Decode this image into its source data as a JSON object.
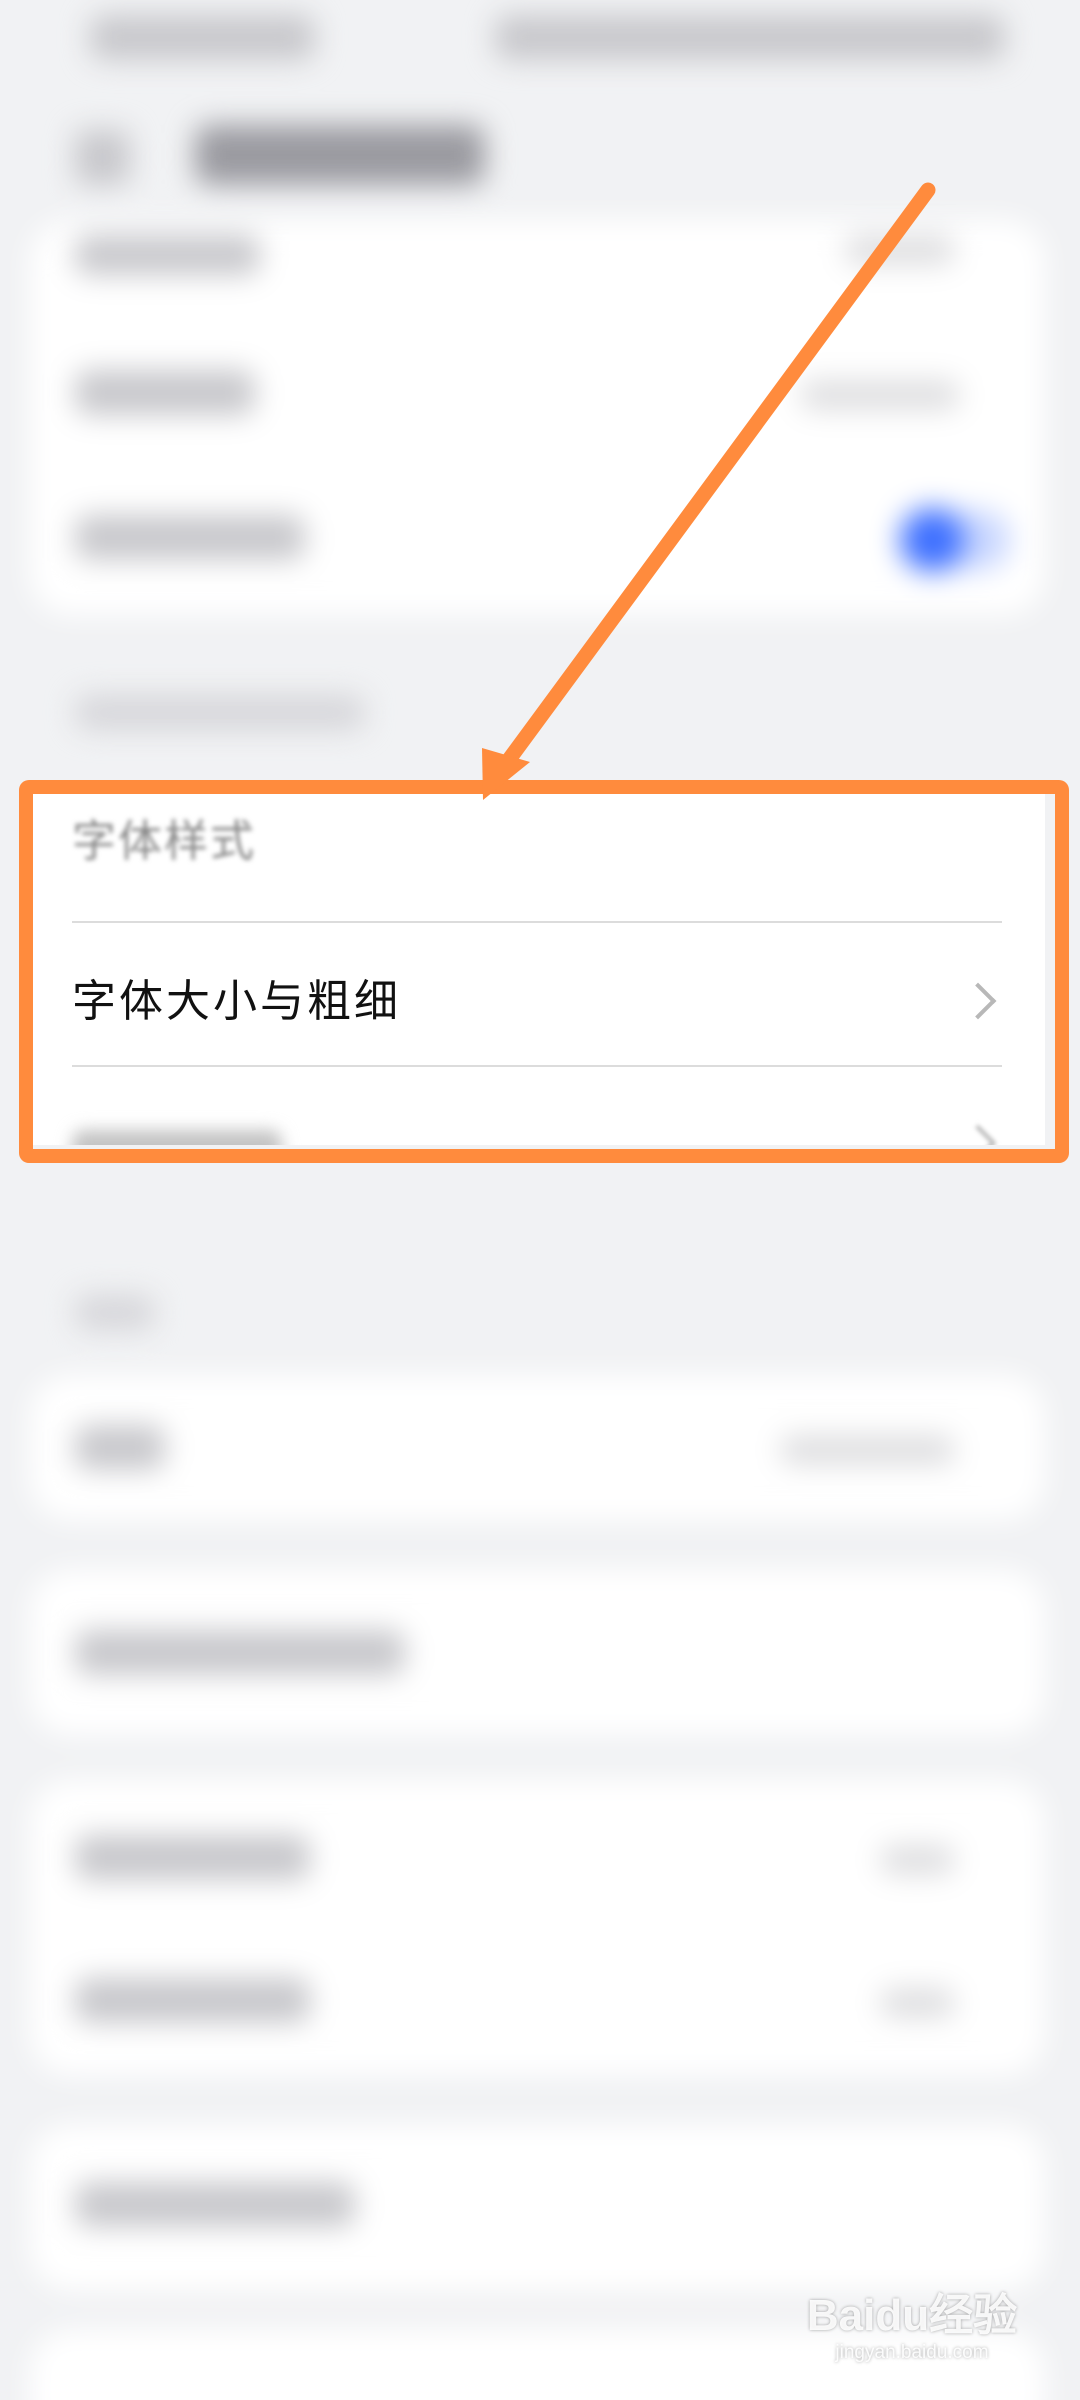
{
  "settings": {
    "font_style_label": "字体样式",
    "font_size_weight_label": "字体大小与粗细"
  },
  "annotation": {
    "highlight_color": "#ff8b3d",
    "arrow_color": "#ff8b3d"
  },
  "watermark": {
    "brand": "Baidu经验",
    "url": "jingyan.baidu.com"
  },
  "icons": {
    "chevron": "chevron-right-icon"
  }
}
